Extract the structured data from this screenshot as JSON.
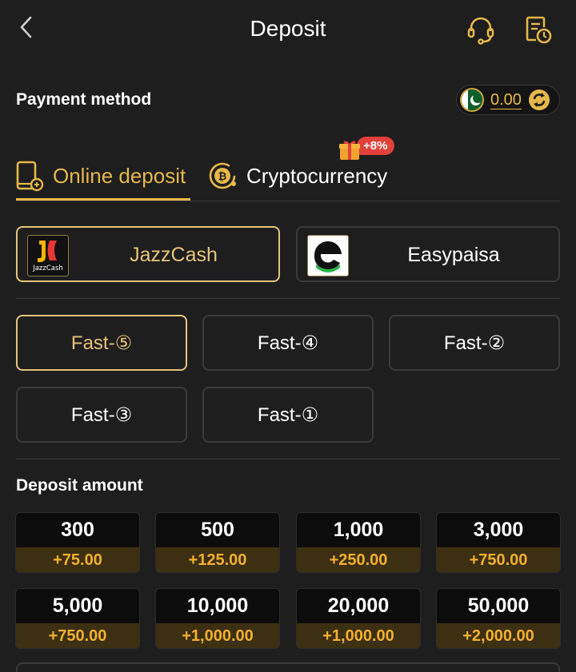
{
  "header": {
    "title": "Deposit",
    "back_icon": "chevron-left-icon",
    "support_icon": "headset-icon",
    "history_icon": "record-clock-icon"
  },
  "payment_method": {
    "label": "Payment method",
    "balance": "0.00",
    "flag_icon": "pakistan-flag-icon",
    "refresh_icon": "refresh-icon"
  },
  "tabs": [
    {
      "label": "Online deposit",
      "icon": "phone-deposit-icon",
      "active": true
    },
    {
      "label": "Cryptocurrency",
      "icon": "bitcoin-icon",
      "active": false,
      "badge": "+8%"
    }
  ],
  "channels": [
    {
      "label": "JazzCash",
      "logo_text": "JazzCash",
      "selected": true
    },
    {
      "label": "Easypaisa",
      "selected": false
    }
  ],
  "fast_options": [
    "Fast-⑤",
    "Fast-④",
    "Fast-②",
    "Fast-③",
    "Fast-①"
  ],
  "deposit_amount": {
    "label": "Deposit amount",
    "options": [
      {
        "amount": "300",
        "bonus": "+75.00"
      },
      {
        "amount": "500",
        "bonus": "+125.00"
      },
      {
        "amount": "1,000",
        "bonus": "+250.00"
      },
      {
        "amount": "3,000",
        "bonus": "+750.00"
      },
      {
        "amount": "5,000",
        "bonus": "+750.00"
      },
      {
        "amount": "10,000",
        "bonus": "+1,000.00"
      },
      {
        "amount": "20,000",
        "bonus": "+1,000.00"
      },
      {
        "amount": "50,000",
        "bonus": "+2,000.00"
      }
    ]
  },
  "colors": {
    "accent": "#e6b84a",
    "background": "#1e1e1e",
    "bonus_text": "#f2b02e",
    "badge_red": "#e0413a"
  }
}
